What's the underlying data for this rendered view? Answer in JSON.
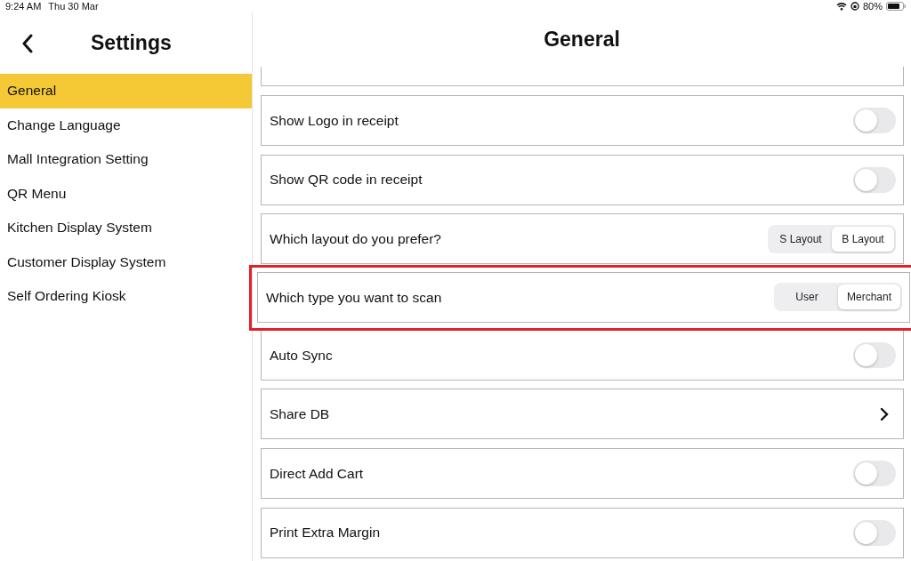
{
  "status_bar": {
    "time": "9:24 AM",
    "date": "Thu 30 Mar",
    "battery": "80%"
  },
  "sidebar": {
    "title": "Settings",
    "items": [
      {
        "label": "General",
        "selected": true
      },
      {
        "label": "Change Language",
        "selected": false
      },
      {
        "label": "Mall Integration Setting",
        "selected": false
      },
      {
        "label": "QR Menu",
        "selected": false
      },
      {
        "label": "Kitchen Display System",
        "selected": false
      },
      {
        "label": "Customer Display System",
        "selected": false
      },
      {
        "label": "Self Ordering Kiosk",
        "selected": false
      }
    ]
  },
  "main": {
    "title": "General",
    "rows": [
      {
        "kind": "toggle",
        "label": "Show Logo in receipt",
        "on": false,
        "highlighted": false
      },
      {
        "kind": "toggle",
        "label": "Show QR code in receipt",
        "on": false,
        "highlighted": false
      },
      {
        "kind": "segmented",
        "label": "Which layout do you prefer?",
        "highlighted": false,
        "options": [
          {
            "label": "S Layout",
            "selected": false
          },
          {
            "label": "B Layout",
            "selected": true
          }
        ]
      },
      {
        "kind": "segmented",
        "label": "Which type you want to scan",
        "highlighted": true,
        "options": [
          {
            "label": "User",
            "selected": false
          },
          {
            "label": "Merchant",
            "selected": true
          }
        ]
      },
      {
        "kind": "toggle",
        "label": "Auto Sync",
        "on": false,
        "highlighted": false
      },
      {
        "kind": "link",
        "label": "Share DB",
        "highlighted": false
      },
      {
        "kind": "toggle",
        "label": "Direct Add Cart",
        "on": false,
        "highlighted": false
      },
      {
        "kind": "toggle",
        "label": "Print Extra Margin",
        "on": false,
        "highlighted": false
      }
    ]
  }
}
